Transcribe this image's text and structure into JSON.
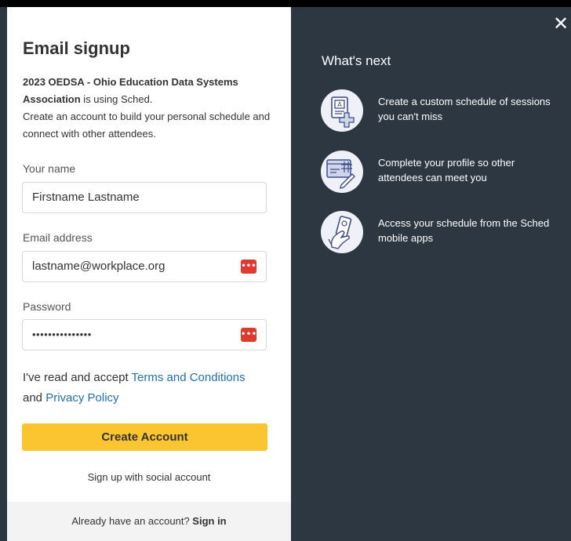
{
  "signup": {
    "title": "Email signup",
    "intro_org": "2023 OEDSA - Ohio Education Data Systems Association",
    "intro_using": " is using Sched.",
    "intro_desc": "Create an account to build your personal schedule and connect with other attendees.",
    "name_label": "Your name",
    "name_value": "Firstname Lastname",
    "email_label": "Email address",
    "email_value": "lastname@workplace.org",
    "password_label": "Password",
    "password_value": "•••••••••••••••",
    "terms_prefix": "I've read and accept ",
    "terms_link": "Terms and Conditions",
    "terms_and": " and ",
    "privacy_link": "Privacy Policy",
    "create_button": "Create Account",
    "social_link": "Sign up with social account",
    "footer_text": "Already have an account? ",
    "footer_link": "Sign in"
  },
  "next": {
    "close_label": "✕",
    "title": "What's next",
    "items": [
      {
        "icon": "schedule-calendar-icon",
        "text": "Create a custom schedule of sessions you can't miss"
      },
      {
        "icon": "profile-edit-icon",
        "text": "Complete your profile so other attendees can meet you"
      },
      {
        "icon": "mobile-app-icon",
        "text": "Access your schedule from the Sched mobile apps"
      }
    ]
  },
  "colors": {
    "dark_panel": "#2d3741",
    "button_yellow": "#fbc531",
    "link_blue": "#1f6fb5",
    "password_manager_red": "#e03a2f"
  }
}
